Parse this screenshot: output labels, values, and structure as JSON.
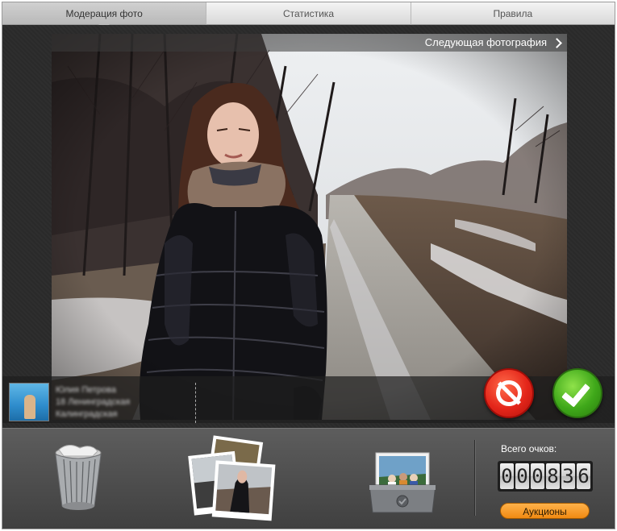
{
  "tabs": [
    {
      "label": "Модерация фото",
      "active": true
    },
    {
      "label": "Статистика",
      "active": false
    },
    {
      "label": "Правила",
      "active": false
    }
  ],
  "photo": {
    "next_label": "Следующая фотография"
  },
  "user": {
    "line1": "Юлия Петрова",
    "line2": "18 Ленинградская",
    "line3": "Калинградская"
  },
  "actions": {
    "reject_icon": "forbidden-icon",
    "approve_icon": "checkmark-icon",
    "reject_color": "#e4261a",
    "approve_color": "#3fa81a"
  },
  "toolbar": {
    "trash_icon": "trash-icon",
    "photos_icon": "photo-stack-icon",
    "inbox_icon": "photo-inbox-icon"
  },
  "score": {
    "label": "Всего очков:",
    "digits": [
      "0",
      "0",
      "0",
      "8",
      "3",
      "6"
    ]
  },
  "auction_label": "Аукционы"
}
